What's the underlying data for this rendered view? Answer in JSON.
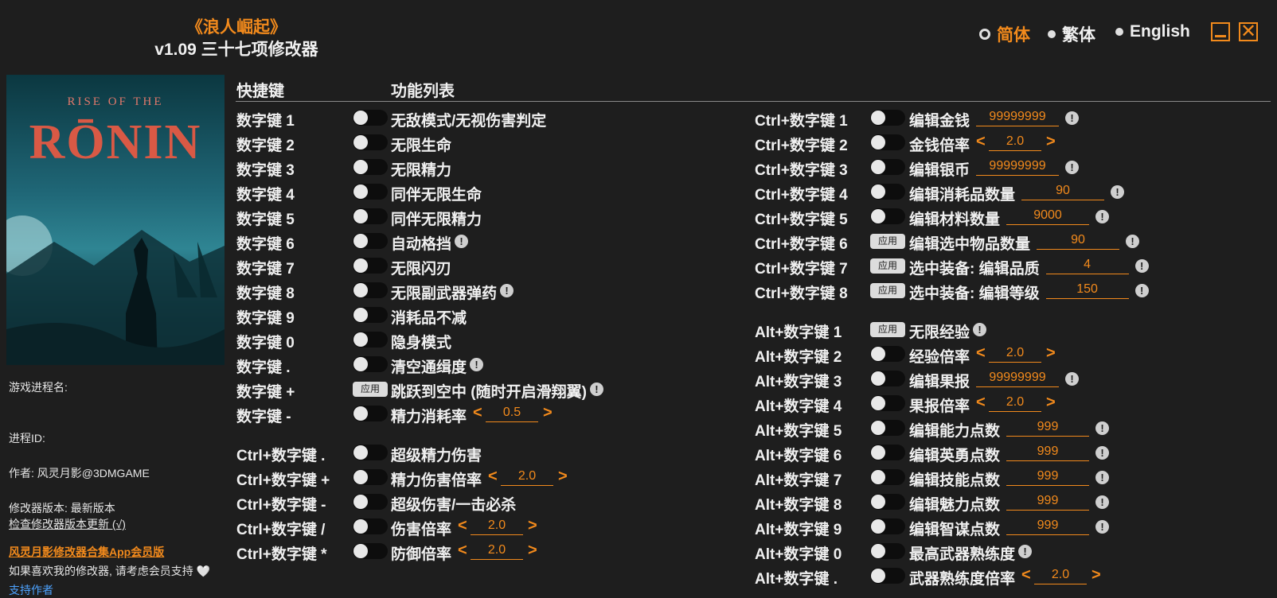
{
  "header": {
    "game_title": "《浪人崛起》",
    "version_title": "v1.09 三十七项修改器"
  },
  "languages": [
    {
      "label": "简体",
      "selected": true,
      "color": "#f28a1c"
    },
    {
      "label": "繁体",
      "selected": false
    },
    {
      "label": "English",
      "selected": false
    }
  ],
  "cover": {
    "line1": "RISE OF THE",
    "line2": "RŌNIN"
  },
  "sidebar": {
    "process_name_label": "游戏进程名:",
    "process_id_label": "进程ID:",
    "author": "作者: 风灵月影@3DMGAME",
    "trainer_version": "修改器版本: 最新版本",
    "check_update": "检查修改器版本更新 (√)",
    "app_link": "风灵月影修改器合集App会员版",
    "support_text": "如果喜欢我的修改器, 请考虑会员支持 🤍",
    "support_link": "支持作者"
  },
  "columns": {
    "hotkey": "快捷键",
    "features": "功能列表"
  },
  "apply_label": "应用",
  "left_list": [
    {
      "key": "数字键 1",
      "control": "toggle",
      "label": "无敌模式/无视伤害判定"
    },
    {
      "key": "数字键 2",
      "control": "toggle",
      "label": "无限生命"
    },
    {
      "key": "数字键 3",
      "control": "toggle",
      "label": "无限精力"
    },
    {
      "key": "数字键 4",
      "control": "toggle",
      "label": "同伴无限生命"
    },
    {
      "key": "数字键 5",
      "control": "toggle",
      "label": "同伴无限精力"
    },
    {
      "key": "数字键 6",
      "control": "toggle",
      "label": "自动格挡",
      "info": true
    },
    {
      "key": "数字键 7",
      "control": "toggle",
      "label": "无限闪刃"
    },
    {
      "key": "数字键 8",
      "control": "toggle",
      "label": "无限副武器弹药",
      "info": true
    },
    {
      "key": "数字键 9",
      "control": "toggle",
      "label": "消耗品不减"
    },
    {
      "key": "数字键 0",
      "control": "toggle",
      "label": "隐身模式"
    },
    {
      "key": "数字键 .",
      "control": "toggle",
      "label": "清空通缉度",
      "info": true
    },
    {
      "key": "数字键 +",
      "control": "apply",
      "label": "跳跃到空中 (随时开启滑翔翼)",
      "info": true
    },
    {
      "key": "数字键 -",
      "control": "toggle",
      "label": "精力消耗率",
      "stepper": "0.5"
    },
    {
      "key": "Ctrl+数字键 .",
      "control": "toggle",
      "label": "超级精力伤害",
      "gap": true
    },
    {
      "key": "Ctrl+数字键 +",
      "control": "toggle",
      "label": "精力伤害倍率",
      "stepper": "2.0"
    },
    {
      "key": "Ctrl+数字键 -",
      "control": "toggle",
      "label": "超级伤害/一击必杀"
    },
    {
      "key": "Ctrl+数字键 /",
      "control": "toggle",
      "label": "伤害倍率",
      "stepper": "2.0"
    },
    {
      "key": "Ctrl+数字键 *",
      "control": "toggle",
      "label": "防御倍率",
      "stepper": "2.0"
    }
  ],
  "right_list": [
    {
      "key": "Ctrl+数字键 1",
      "control": "toggle",
      "label": "编辑金钱",
      "value": "99999999",
      "info": true
    },
    {
      "key": "Ctrl+数字键 2",
      "control": "toggle",
      "label": "金钱倍率",
      "stepper": "2.0"
    },
    {
      "key": "Ctrl+数字键 3",
      "control": "toggle",
      "label": "编辑银币",
      "value": "99999999",
      "info": true
    },
    {
      "key": "Ctrl+数字键 4",
      "control": "toggle",
      "label": "编辑消耗品数量",
      "value": "90",
      "info": true
    },
    {
      "key": "Ctrl+数字键 5",
      "control": "toggle",
      "label": "编辑材料数量",
      "value": "9000",
      "info": true
    },
    {
      "key": "Ctrl+数字键 6",
      "control": "apply",
      "label": "编辑选中物品数量",
      "value": "90",
      "info": true
    },
    {
      "key": "Ctrl+数字键 7",
      "control": "apply",
      "label": "选中装备: 编辑品质",
      "value": "4",
      "info": true
    },
    {
      "key": "Ctrl+数字键 8",
      "control": "apply",
      "label": "选中装备: 编辑等级",
      "value": "150",
      "info": true
    },
    {
      "key": "Alt+数字键 1",
      "control": "apply",
      "label": "无限经验",
      "info": true,
      "gap": true
    },
    {
      "key": "Alt+数字键 2",
      "control": "toggle",
      "label": "经验倍率",
      "stepper": "2.0"
    },
    {
      "key": "Alt+数字键 3",
      "control": "toggle",
      "label": "编辑果报",
      "value": "99999999",
      "info": true
    },
    {
      "key": "Alt+数字键 4",
      "control": "toggle",
      "label": "果报倍率",
      "stepper": "2.0"
    },
    {
      "key": "Alt+数字键 5",
      "control": "toggle",
      "label": "编辑能力点数",
      "value": "999",
      "info": true
    },
    {
      "key": "Alt+数字键 6",
      "control": "toggle",
      "label": "编辑英勇点数",
      "value": "999",
      "info": true
    },
    {
      "key": "Alt+数字键 7",
      "control": "toggle",
      "label": "编辑技能点数",
      "value": "999",
      "info": true
    },
    {
      "key": "Alt+数字键 8",
      "control": "toggle",
      "label": "编辑魅力点数",
      "value": "999",
      "info": true
    },
    {
      "key": "Alt+数字键 9",
      "control": "toggle",
      "label": "编辑智谋点数",
      "value": "999",
      "info": true
    },
    {
      "key": "Alt+数字键 0",
      "control": "toggle",
      "label": "最高武器熟练度",
      "info": true
    },
    {
      "key": "Alt+数字键 .",
      "control": "toggle",
      "label": "武器熟练度倍率",
      "stepper": "2.0"
    }
  ]
}
